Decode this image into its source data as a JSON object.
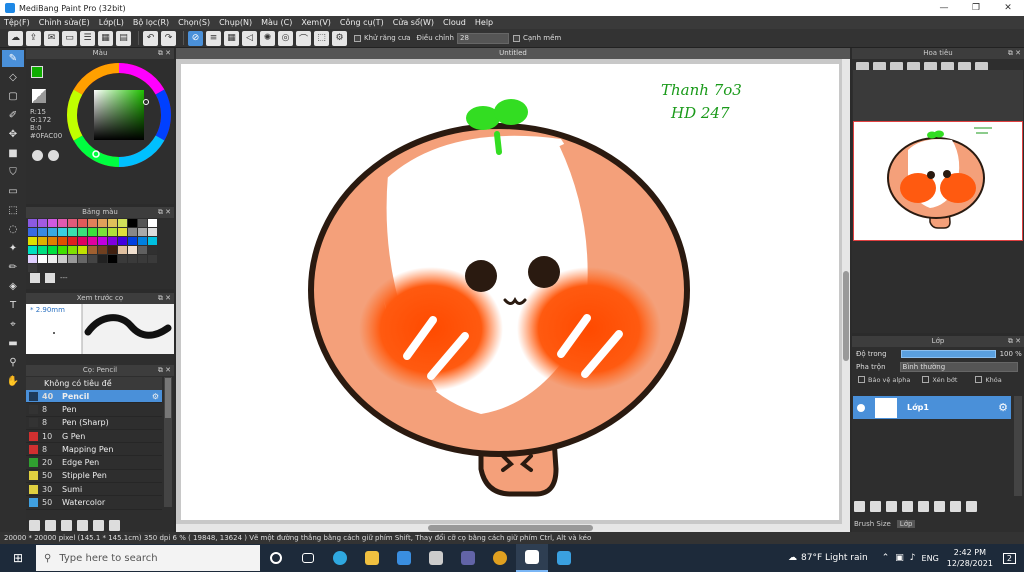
{
  "window": {
    "title": "MediBang Paint Pro (32bit)",
    "minimize": "—",
    "maximize": "❐",
    "close": "✕"
  },
  "menu": [
    "Tệp(F)",
    "Chỉnh sửa(E)",
    "Lớp(L)",
    "Bộ lọc(R)",
    "Chọn(S)",
    "Chụp(N)",
    "Màu (C)",
    "Xem(V)",
    "Công cụ(T)",
    "Cửa sổ(W)",
    "Cloud",
    "Help"
  ],
  "toolbar": {
    "antialias_label": "Khử răng cưa",
    "adjust_label": "Điều chỉnh",
    "adjust_value": "28",
    "edge_label": "Cạnh mềm"
  },
  "color_panel": {
    "title": "Màu",
    "r": "R:15",
    "g": "G:172",
    "b": "B:0",
    "hex": "#0FAC00",
    "primary": "#0FAC00",
    "secondary": "#e85a1a"
  },
  "palette_panel": {
    "title": "Bảng màu",
    "more": "---",
    "colors": [
      "#8c5ae0",
      "#a45ae0",
      "#d05ae0",
      "#e05ab0",
      "#e05a7a",
      "#e05a5a",
      "#e0805a",
      "#e0a05a",
      "#e0c05a",
      "#d0e05a",
      "#000000",
      "#555555",
      "#ffffff",
      "#3a6ae0",
      "#3a8ae0",
      "#3aaae0",
      "#3ad0e0",
      "#3ae0b0",
      "#3ae07a",
      "#3ae03a",
      "#7ae03a",
      "#b0e03a",
      "#e0e03a",
      "#888888",
      "#aaaaaa",
      "#dddddd",
      "#e0e000",
      "#e0b000",
      "#e08000",
      "#e05000",
      "#e02020",
      "#e00060",
      "#e000a0",
      "#c000e0",
      "#8000e0",
      "#4000e0",
      "#0040e0",
      "#0080e0",
      "#00c0e0",
      "#00e0c0",
      "#00e080",
      "#00e040",
      "#40e000",
      "#80e000",
      "#c0e000",
      "#a06030",
      "#704020",
      "#402010",
      "#e0c0a0",
      "#f0e0d0",
      "#606060",
      "#303030",
      "#e0d0ff",
      "#ffffff",
      "#eeeeee",
      "#cccccc",
      "#999999",
      "#666666",
      "#444444",
      "#222222",
      "#000000",
      "#3a3a3a",
      "#3a3a3a",
      "#3a3a3a",
      "#3a3a3a",
      "#3a3a3a"
    ]
  },
  "brush_preview": {
    "title": "Xem trước cọ",
    "size": "* 2.90mm"
  },
  "brush_panel": {
    "title": "Cọ: Pencil",
    "group": "Không có tiêu đề",
    "items": [
      {
        "size": "40",
        "name": "Pencil",
        "color": "#1e3a5a",
        "selected": true
      },
      {
        "size": "8",
        "name": "Pen",
        "color": "#333333"
      },
      {
        "size": "8",
        "name": "Pen (Sharp)",
        "color": "#333333"
      },
      {
        "size": "10",
        "name": "G Pen",
        "color": "#d03030"
      },
      {
        "size": "8",
        "name": "Mapping Pen",
        "color": "#d03030"
      },
      {
        "size": "20",
        "name": "Edge Pen",
        "color": "#30a030"
      },
      {
        "size": "50",
        "name": "Stipple Pen",
        "color": "#e0d040"
      },
      {
        "size": "30",
        "name": "Sumi",
        "color": "#e0d040"
      },
      {
        "size": "50",
        "name": "Watercolor",
        "color": "#40a0e0"
      }
    ]
  },
  "canvas": {
    "tab": "Untitled",
    "signature_line1": "Thanh 7o3",
    "signature_line2": "HD 247"
  },
  "navigator": {
    "title": "Hoa tiêu"
  },
  "layer_panel": {
    "title": "Lớp",
    "opacity_label": "Độ trong",
    "opacity_value": "100 %",
    "blend_label": "Pha trộn",
    "blend_value": "Bình thường",
    "protect_alpha": "Bảo vệ alpha",
    "clipping": "Xén bớt",
    "lock": "Khóa",
    "layer_name": "Lớp1",
    "tab_brush_size": "Brush Size",
    "tab_layer": "Lớp"
  },
  "status": {
    "text": "20000 * 20000 pixel   (145.1 * 145.1cm)   350 dpi   6 %   ( 19848, 13624 )   Vẽ một đường thẳng bằng cách giữ phím Shift, Thay đổi cỡ cọ bằng cách giữ phím Ctrl, Alt và kéo"
  },
  "taskbar": {
    "search_placeholder": "Type here to search",
    "weather": "87°F  Light rain",
    "lang": "ENG",
    "time": "2:42 PM",
    "date": "12/28/2021",
    "notif": "2"
  }
}
